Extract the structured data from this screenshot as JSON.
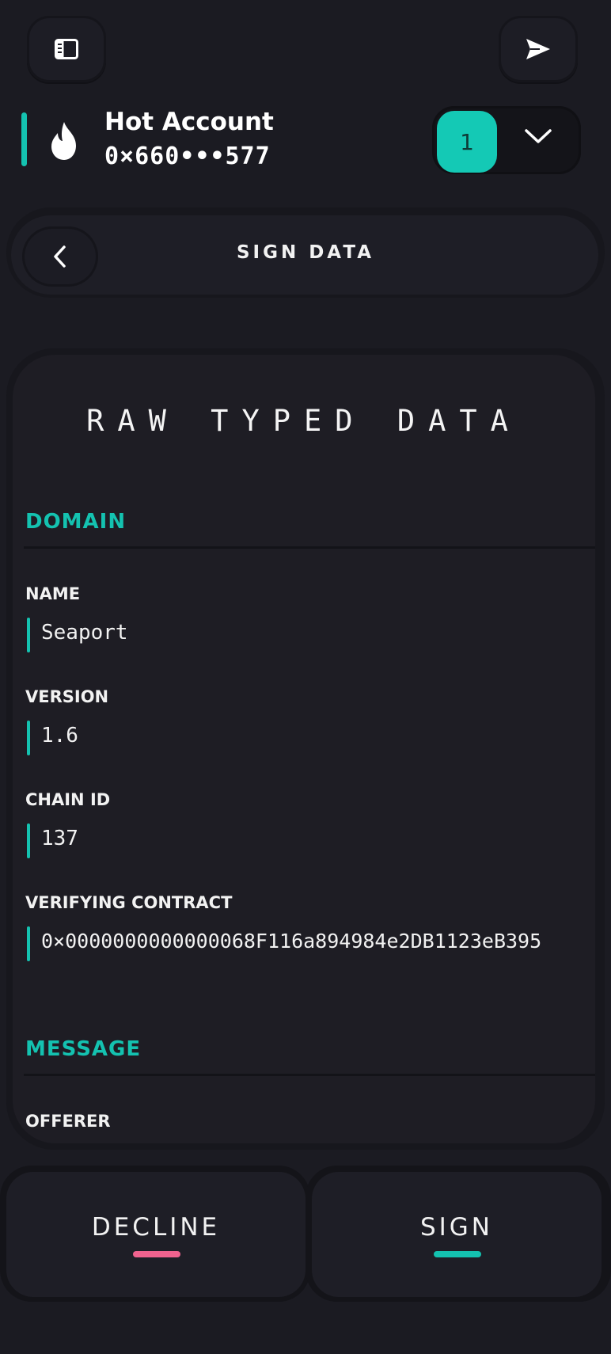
{
  "account": {
    "name": "Hot Account",
    "address": "0×660•••577",
    "number": "1"
  },
  "header": {
    "title": "SIGN DATA"
  },
  "card": {
    "title": "RAW TYPED DATA",
    "domain": {
      "section_label": "DOMAIN",
      "name_label": "NAME",
      "name_value": "Seaport",
      "version_label": "VERSION",
      "version_value": "1.6",
      "chain_label": "CHAIN ID",
      "chain_value": "137",
      "contract_label": "VERIFYING CONTRACT",
      "contract_value": "0×0000000000000068F116a894984e2DB1123eB395"
    },
    "message": {
      "section_label": "MESSAGE",
      "offerer_label": "OFFERER"
    }
  },
  "actions": {
    "decline_label": "DECLINE",
    "sign_label": "SIGN"
  },
  "colors": {
    "accent": "#14c2b0",
    "decline": "#f0628e",
    "background": "#1b1b22"
  },
  "icons": {
    "top_left": "sidebar-panel-icon",
    "top_right": "send-icon",
    "account": "flame-icon",
    "switcher": "chevron-down-icon",
    "back": "chevron-left-icon"
  }
}
